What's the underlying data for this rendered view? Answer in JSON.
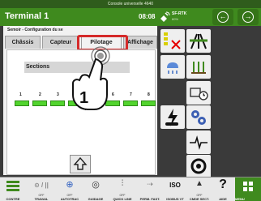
{
  "console_title": "Console universelle 4640",
  "window_title": "Terminal 1",
  "clock": "08:08",
  "gps_label": "SF-RTK",
  "gps_sub": "60%",
  "breadcrumb": "Semoir - Configuration du se",
  "tabs": [
    {
      "label": "Châssis",
      "active": false
    },
    {
      "label": "Capteur",
      "active": false
    },
    {
      "label": "Pilotage",
      "active": true
    },
    {
      "label": "Affichage",
      "active": false
    }
  ],
  "sections_title": "Sections",
  "section_numbers": [
    "1",
    "2",
    "3",
    "4",
    "5",
    "6",
    "7",
    "8"
  ],
  "bottom_bar": [
    {
      "label": "CONTRE",
      "sub": ""
    },
    {
      "label": "TRAVAIL",
      "sub": "OFF"
    },
    {
      "label": "AUTOTRAC",
      "sub": "OFF"
    },
    {
      "label": "GUIDAGE",
      "sub": ""
    },
    {
      "label": "QUICK LINE",
      "sub": "OFF"
    },
    {
      "label": "PERM. FAST.",
      "sub": ""
    },
    {
      "label": "ISOBUS VT",
      "sub": ""
    },
    {
      "label": "CMDE SECT.",
      "sub": "OFF"
    },
    {
      "label": "AIDE",
      "sub": ""
    },
    {
      "label": "MENU",
      "sub": ""
    }
  ],
  "colors": {
    "brand_green": "#3f8a1e",
    "highlight": "#d52a2a",
    "section_on": "#52d42e"
  }
}
